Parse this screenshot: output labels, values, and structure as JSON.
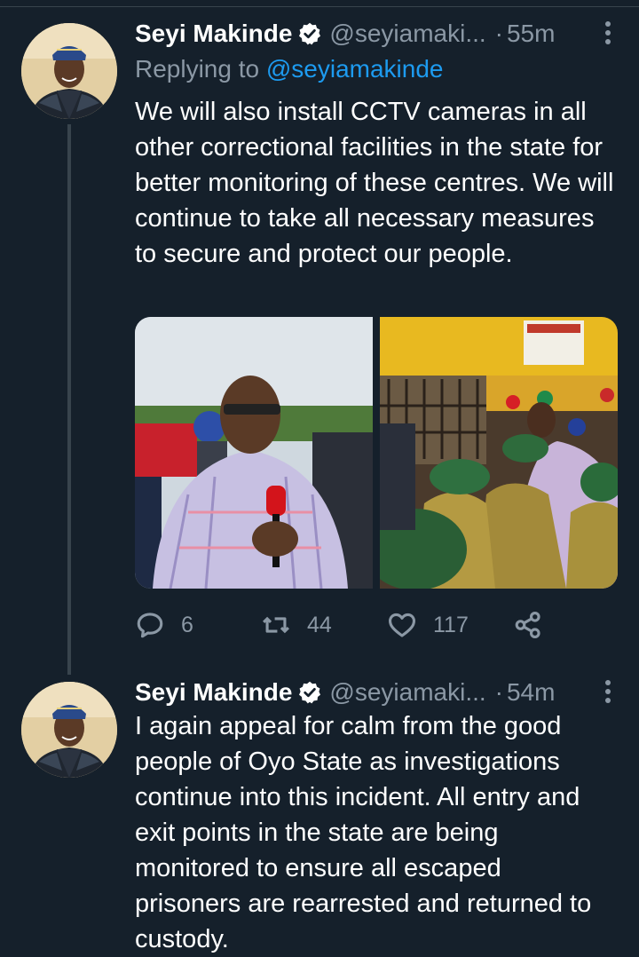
{
  "tweets": [
    {
      "author_name": "Seyi Makinde",
      "handle": "@seyiamaki...",
      "time": "55m",
      "replying_label": "Replying to",
      "replying_to": "@seyiamakinde",
      "text": "We will also install CCTV cameras in all other correctional facilities in the state for better monitoring of these centres. We will continue to take all necessary measures to secure and protect our people.",
      "media": [
        "photo-speaker-with-microphone",
        "photo-crowd-with-officers"
      ],
      "stats": {
        "replies": "6",
        "retweets": "44",
        "likes": "117"
      }
    },
    {
      "author_name": "Seyi Makinde",
      "handle": "@seyiamaki...",
      "time": "54m",
      "text": "I again appeal for calm from the good people of Oyo State as investigations continue into this incident. All entry and exit points in the state are being monitored to ensure all escaped prisoners are rearrested and returned to custody."
    }
  ],
  "icons": {
    "verified": "verified-badge-icon",
    "more": "more-vertical-icon",
    "reply": "reply-icon",
    "retweet": "retweet-icon",
    "like": "heart-icon",
    "share": "share-icon"
  },
  "colors": {
    "background": "#15202b",
    "text": "#ffffff",
    "secondary": "#8b98a5",
    "accent": "#1d9bf0",
    "divider": "#38444d"
  }
}
